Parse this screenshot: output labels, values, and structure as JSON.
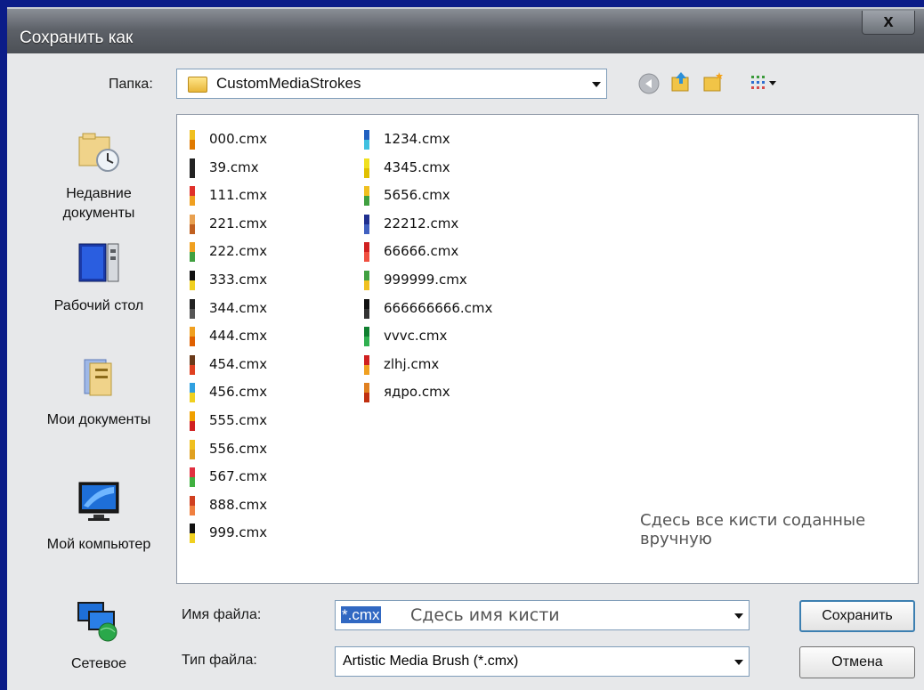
{
  "window": {
    "title": "Сохранить как",
    "close_label": "x"
  },
  "folder_bar": {
    "label": "Папка:",
    "current_folder": "CustomMediaStrokes",
    "toolbar_icons": [
      "back-icon",
      "up-folder-icon",
      "new-folder-icon",
      "view-menu-icon"
    ]
  },
  "places": [
    {
      "label": "Недавние документы",
      "icon": "recent-documents-icon"
    },
    {
      "label": "Рабочий стол",
      "icon": "desktop-icon"
    },
    {
      "label": "Мои документы",
      "icon": "my-documents-icon"
    },
    {
      "label": "Мой компьютер",
      "icon": "my-computer-icon"
    },
    {
      "label": "Сетевое",
      "icon": "network-icon"
    }
  ],
  "files_col1": [
    "000.cmx",
    "39.cmx",
    "111.cmx",
    "221.cmx",
    "222.cmx",
    "333.cmx",
    "344.cmx",
    "444.cmx",
    "454.cmx",
    "456.cmx",
    "555.cmx",
    "556.cmx",
    "567.cmx",
    "888.cmx",
    "999.cmx"
  ],
  "files_col2": [
    "1234.cmx",
    "4345.cmx",
    "5656.cmx",
    "22212.cmx",
    "66666.cmx",
    "999999.cmx",
    "666666666.cmx",
    "vvvc.cmx",
    "zlhj.cmx",
    "ядро.cmx"
  ],
  "annotation": "Сдесь все кисти соданные вручную",
  "filename": {
    "label": "Имя файла:",
    "value": "*.cmx",
    "hint": "Сдесь имя кисти"
  },
  "filetype": {
    "label": "Тип файла:",
    "value": "Artistic Media Brush (*.cmx)"
  },
  "buttons": {
    "save": "Сохранить",
    "cancel": "Отмена"
  },
  "colors": {
    "frame": "#0b1c88",
    "dialog": "#e7e8ea",
    "selection": "#3168c2"
  }
}
